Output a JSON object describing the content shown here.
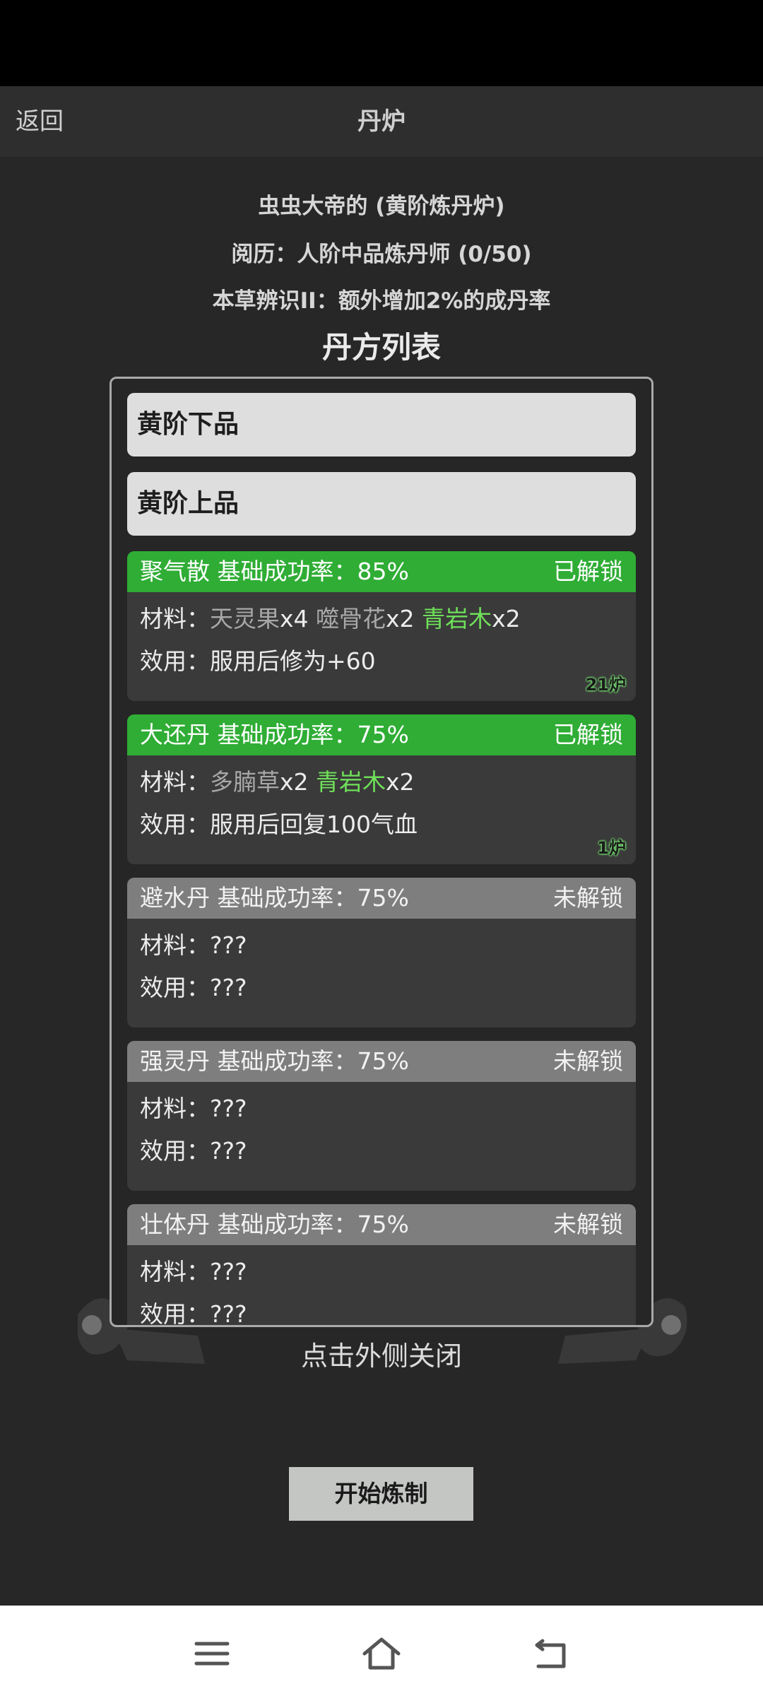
{
  "header": {
    "back_label": "返回",
    "title": "丹炉"
  },
  "info": {
    "furnace_name": "虫虫大帝的 (黄阶炼丹炉)",
    "experience": "阅历：人阶中品炼丹师 (0/50)",
    "skill": "本草辨识II：额外增加2%的成丹率"
  },
  "list_title": "丹方列表",
  "grades": [
    {
      "label": "黄阶下品"
    },
    {
      "label": "黄阶上品"
    }
  ],
  "recipes": [
    {
      "name_rate": "聚气散 基础成功率：85%",
      "status": "已解锁",
      "materials_prefix": "材料：",
      "materials": [
        {
          "text": "天灵果",
          "qty": "x4"
        },
        {
          "text": "噬骨花",
          "qty": "x2"
        },
        {
          "text": "青岩木",
          "qty": "x2"
        }
      ],
      "effect": "效用：服用后修为+60",
      "count": "21炉"
    },
    {
      "name_rate": "大还丹 基础成功率：75%",
      "status": "已解锁",
      "materials_prefix": "材料：",
      "materials": [
        {
          "text": "多腩草",
          "qty": "x2"
        },
        {
          "text": "青岩木",
          "qty": "x2"
        }
      ],
      "effect": "效用：服用后回复100气血",
      "count": "1炉"
    },
    {
      "name_rate": "避水丹 基础成功率：75%",
      "status": "未解锁",
      "materials_line": "材料：???",
      "effect": "效用：???"
    },
    {
      "name_rate": "强灵丹 基础成功率：75%",
      "status": "未解锁",
      "materials_line": "材料：???",
      "effect": "效用：???"
    },
    {
      "name_rate": "壮体丹 基础成功率：75%",
      "status": "未解锁",
      "materials_line": "材料：???",
      "effect": "效用：???"
    }
  ],
  "close_hint": "点击外侧关闭",
  "start_button": "开始炼制",
  "colors": {
    "unlocked": "#2fad35",
    "locked": "#7e7e7e",
    "green_material": "#6fe05a",
    "background": "#262726"
  },
  "nav": {
    "icons": [
      "menu-icon",
      "home-icon",
      "back-icon"
    ]
  }
}
